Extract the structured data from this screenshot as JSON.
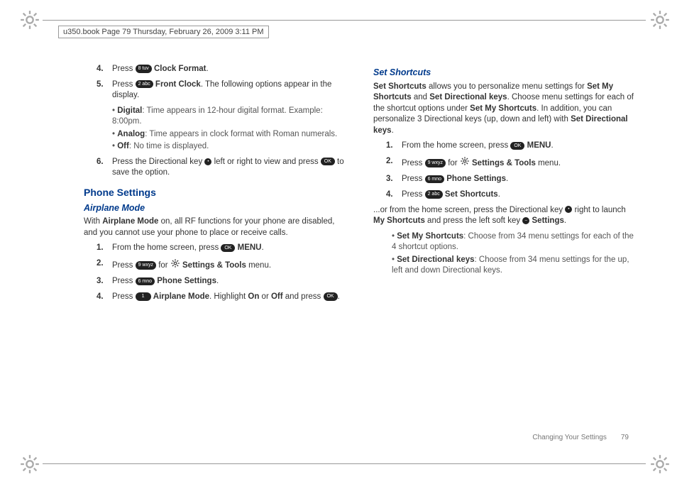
{
  "meta": "u350.book  Page 79  Thursday, February 26, 2009  3:11 PM",
  "left": {
    "cont": [
      {
        "n": "4.",
        "pre": "Press ",
        "key": "8 tuv",
        "after": " ",
        "bold": "Clock Format",
        "post": "."
      },
      {
        "n": "5.",
        "pre": "Press ",
        "key": "2 abc",
        "after": " ",
        "bold": "Front Clock",
        "post": ". The following options appear in the display."
      }
    ],
    "bullets": [
      {
        "b": "Digital",
        "t": ": Time appears in 12-hour digital format. Example: 8:00pm."
      },
      {
        "b": "Analog",
        "t": ": Time appears in clock format with Roman numerals."
      },
      {
        "b": "Off",
        "t": ": No time is displayed."
      }
    ],
    "step6": {
      "n": "6.",
      "pre": "Press the Directional key ",
      "keymid": " left or right to view and press ",
      "post": " to save the option."
    },
    "h2": "Phone Settings",
    "h3": "Airplane Mode",
    "para": {
      "p1": "With ",
      "b1": "Airplane Mode",
      "p2": " on, all RF functions for your phone are disabled, and you cannot use your phone to place or receive calls."
    },
    "steps": [
      {
        "n": "1.",
        "pre": "From the home screen, press ",
        "key": "OK",
        "bold": "MENU",
        "post": "."
      },
      {
        "n": "2.",
        "pre": "Press ",
        "key": "9 wxyz",
        "mid": " for ",
        "gear": true,
        "bold": "Settings & Tools",
        "post": " menu."
      },
      {
        "n": "3.",
        "pre": "Press ",
        "key": "6 mno",
        "bold": "Phone Settings",
        "post": "."
      },
      {
        "n": "4.",
        "pre": "Press ",
        "key": "1",
        "bold": "Airplane Mode",
        "mid2": ". Highlight ",
        "b2": "On",
        "mid3": " or ",
        "b3": "Off",
        "mid4": " and press ",
        "okend": true,
        "post": "."
      }
    ]
  },
  "right": {
    "h3": "Set Shortcuts",
    "para_tokens": [
      {
        "b": 1,
        "t": "Set Shortcuts"
      },
      {
        "t": " allows you to personalize menu settings for "
      },
      {
        "b": 1,
        "t": "Set My Shortcuts"
      },
      {
        "t": " and "
      },
      {
        "b": 1,
        "t": "Set Directional keys"
      },
      {
        "t": ". Choose menu settings for each of the shortcut options under "
      },
      {
        "b": 1,
        "t": "Set My Shortcuts"
      },
      {
        "t": ". In addition, you can personalize 3 Directional keys (up, down and left) with "
      },
      {
        "b": 1,
        "t": "Set Directional keys"
      },
      {
        "t": "."
      }
    ],
    "steps": [
      {
        "n": "1.",
        "pre": "From the home screen, press ",
        "key": "OK",
        "bold": "MENU",
        "post": "."
      },
      {
        "n": "2.",
        "pre": "Press ",
        "key": "9 wxyz",
        "mid": " for ",
        "gear": true,
        "bold": "Settings & Tools",
        "post": " menu."
      },
      {
        "n": "3.",
        "pre": "Press ",
        "key": "6 mno",
        "bold": "Phone Settings",
        "post": "."
      },
      {
        "n": "4.",
        "pre": "Press ",
        "key": "2 abc",
        "bold": "Set Shortcuts",
        "post": "."
      }
    ],
    "alt_tokens": {
      "p1": "...or from the home screen, press the Directional key ",
      "mid": " right to launch ",
      "b1": "My Shortcuts",
      "mid2": " and press the left soft key ",
      "b2": "Settings",
      "post": "."
    },
    "bullets2": [
      {
        "b": "Set My Shortcuts",
        "t": ": Choose from 34 menu settings for each of the 4 shortcut options."
      },
      {
        "b": "Set Directional keys",
        "t": ": Choose from 34 menu settings for the up, left and down Directional keys."
      }
    ]
  },
  "footer": {
    "label": "Changing Your Settings",
    "page": "79"
  }
}
